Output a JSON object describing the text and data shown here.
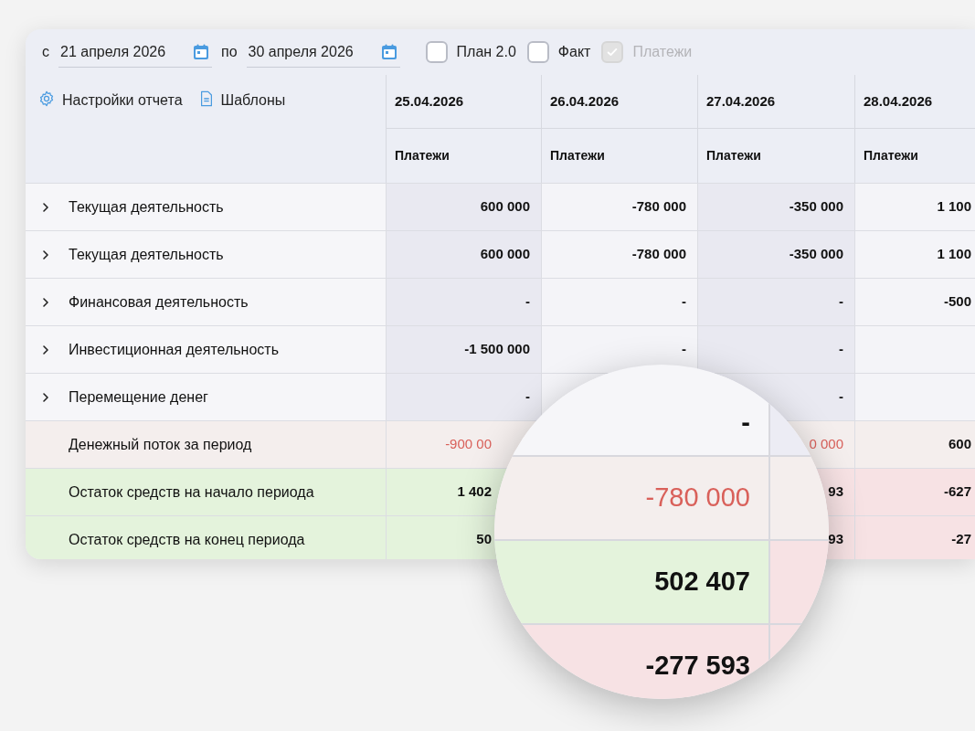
{
  "filters": {
    "from_label": "с",
    "from_date": "21 апреля 2026",
    "to_label": "по",
    "to_date": "30 апреля 2026",
    "checkboxes": [
      {
        "label": "План 2.0",
        "checked": false,
        "disabled": false
      },
      {
        "label": "Факт",
        "checked": false,
        "disabled": false
      },
      {
        "label": "Платежи",
        "checked": true,
        "disabled": true
      }
    ]
  },
  "toolbar": {
    "settings": "Настройки отчета",
    "templates": "Шаблоны"
  },
  "table": {
    "columns": [
      {
        "date": "25.04.2026",
        "sub": "Платежи"
      },
      {
        "date": "26.04.2026",
        "sub": "Платежи"
      },
      {
        "date": "27.04.2026",
        "sub": "Платежи"
      },
      {
        "date": "28.04.2026",
        "sub": "Платежи"
      }
    ],
    "rows": [
      {
        "kind": "group",
        "label": "Текущая деятельность",
        "cells": [
          {
            "text": "600 000"
          },
          {
            "text": "-780 000"
          },
          {
            "text": "-350 000"
          },
          {
            "text": "1 100"
          }
        ]
      },
      {
        "kind": "group",
        "label": "Текущая деятельность",
        "cells": [
          {
            "text": "600 000"
          },
          {
            "text": "-780 000"
          },
          {
            "text": "-350 000"
          },
          {
            "text": "1 100"
          }
        ]
      },
      {
        "kind": "group",
        "label": "Финансовая деятельность",
        "cells": [
          {
            "text": "-"
          },
          {
            "text": "-"
          },
          {
            "text": "-"
          },
          {
            "text": "-500"
          }
        ]
      },
      {
        "kind": "group",
        "label": "Инвестиционная деятельность",
        "cells": [
          {
            "text": "-1 500 000"
          },
          {
            "text": "-"
          },
          {
            "text": "-"
          },
          {}
        ]
      },
      {
        "kind": "group",
        "label": "Перемещение денег",
        "cells": [
          {
            "text": "-"
          },
          {},
          {
            "text": "-"
          },
          {}
        ]
      },
      {
        "kind": "flow",
        "label": "Денежный поток за период",
        "cells": [
          {
            "text": "-900 00",
            "negative": true,
            "cut": true
          },
          null,
          {
            "text": "0 000",
            "negative": true
          },
          {
            "text": "600",
            "negative": false
          }
        ]
      },
      {
        "kind": "balance",
        "label": "Остаток средств на начало периода",
        "cells": [
          {
            "text": "1 402",
            "negative": false,
            "cut": true
          },
          null,
          {
            "text": "93",
            "negative": true
          },
          {
            "text": "-627",
            "negative": true
          }
        ]
      },
      {
        "kind": "balance",
        "label": "Остаток средств на конец периода",
        "cells": [
          {
            "text": "50",
            "negative": false,
            "cut": true
          },
          null,
          {
            "text": "93",
            "negative": true
          },
          {
            "text": "-27",
            "negative": true
          }
        ]
      }
    ]
  },
  "lens": {
    "rows": [
      {
        "kind": "group",
        "text": "-"
      },
      {
        "kind": "flow",
        "text": "-780 000",
        "negative": true
      },
      {
        "kind": "balance",
        "text": "502 407",
        "negative": false
      },
      {
        "kind": "balance",
        "text": "-277 593",
        "negative": true
      }
    ]
  }
}
